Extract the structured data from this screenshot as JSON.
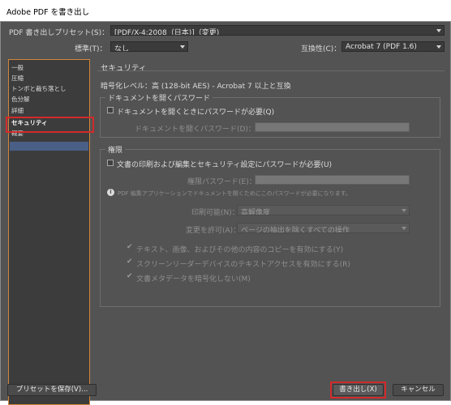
{
  "window": {
    "title": "Adobe PDF を書き出し"
  },
  "header": {
    "preset_label": "PDF 書き出しプリセット(S)：",
    "preset_value": "[PDF/X-4:2008（日本)]（変更)",
    "standard_label": "標準(T)：",
    "standard_value": "なし",
    "compat_label": "互換性(C)：",
    "compat_value": "Acrobat 7 (PDF 1.6)"
  },
  "sidebar": {
    "items": [
      {
        "label": "一般"
      },
      {
        "label": "圧縮"
      },
      {
        "label": "トンボと裁ち落とし"
      },
      {
        "label": "色分解"
      },
      {
        "label": "詳細"
      },
      {
        "label": "セキュリティ"
      },
      {
        "label": "概要"
      }
    ],
    "selected_index": 5
  },
  "main": {
    "section_title": "セキュリティ",
    "encryption_level": "暗号化レベル：高 (128-bit AES) - Acrobat 7 以上と互換",
    "open_doc_group": {
      "title": "ドキュメントを開くパスワード",
      "require_label": "ドキュメントを開くときにパスワードが必要(Q)",
      "require_checked": false,
      "password_label": "ドキュメントを開くパスワード(D)："
    },
    "perm_group": {
      "title": "権限",
      "require_label": "文書の印刷および編集とセキュリティ設定にパスワードが必要(U)",
      "require_checked": false,
      "password_label": "権限パスワード(E)：",
      "info_text": "PDF 編集アプリケーションでドキュメントを開くためにこのパスワードが必要になります。",
      "print_label": "印刷可能(N)：",
      "print_value": "高解像度",
      "changes_label": "変更を許可(A)：",
      "changes_value": "ページの抽出を除くすべての操作",
      "options": [
        {
          "label": "テキスト、画像、およびその他の内容のコピーを有効にする(Y)",
          "checked": true
        },
        {
          "label": "スクリーンリーダーデバイスのテキストアクセスを有効にする(R)",
          "checked": true
        },
        {
          "label": "文書メタデータを暗号化しない(M)",
          "checked": true
        }
      ]
    }
  },
  "footer": {
    "save_preset": "プリセットを保存(V)...",
    "export": "書き出し(X)",
    "cancel": "キャンセル"
  },
  "colors": {
    "dialog_bg": "#535353",
    "highlight_red": "#d22a2a",
    "sidebar_border": "#d2863a"
  }
}
